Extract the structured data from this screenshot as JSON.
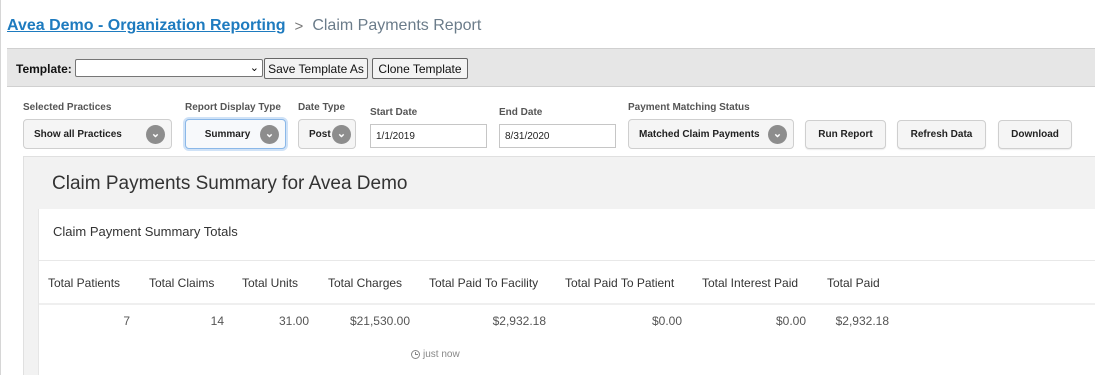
{
  "breadcrumb": {
    "parent": "Avea Demo - Organization Reporting",
    "separator": ">",
    "current": "Claim Payments Report"
  },
  "template_bar": {
    "label": "Template:",
    "selected_value": "",
    "save_as_label": "Save Template As",
    "clone_label": "Clone Template"
  },
  "filters": {
    "practices": {
      "label": "Selected Practices",
      "value": "Show all Practices"
    },
    "display_type": {
      "label": "Report Display Type",
      "value": "Summary"
    },
    "date_type": {
      "label": "Date Type",
      "value": "Post"
    },
    "start_date": {
      "label": "Start Date",
      "value": "1/1/2019"
    },
    "end_date": {
      "label": "End Date",
      "value": "8/31/2020"
    },
    "matching": {
      "label": "Payment Matching Status",
      "value": "Matched Claim Payments"
    },
    "run_label": "Run Report",
    "refresh_label": "Refresh Data",
    "download_label": "Download"
  },
  "report": {
    "title": "Claim Payments Summary for Avea Demo",
    "card_title": "Claim Payment Summary Totals",
    "columns": [
      "Total Patients",
      "Total Claims",
      "Total Units",
      "Total Charges",
      "Total Paid To Facility",
      "Total Paid To Patient",
      "Total Interest Paid",
      "Total Paid"
    ],
    "values": [
      "7",
      "14",
      "31.00",
      "$21,530.00",
      "$2,932.18",
      "$0.00",
      "$0.00",
      "$2,932.18"
    ],
    "updated": "just now"
  },
  "icons": {
    "select_chevron": "chevron-down-icon",
    "updated": "clock-icon"
  },
  "colors": {
    "link": "#1e7bbf",
    "chevron_circle": "#8d8d8d",
    "focus_ring": "#8bb8e8"
  }
}
